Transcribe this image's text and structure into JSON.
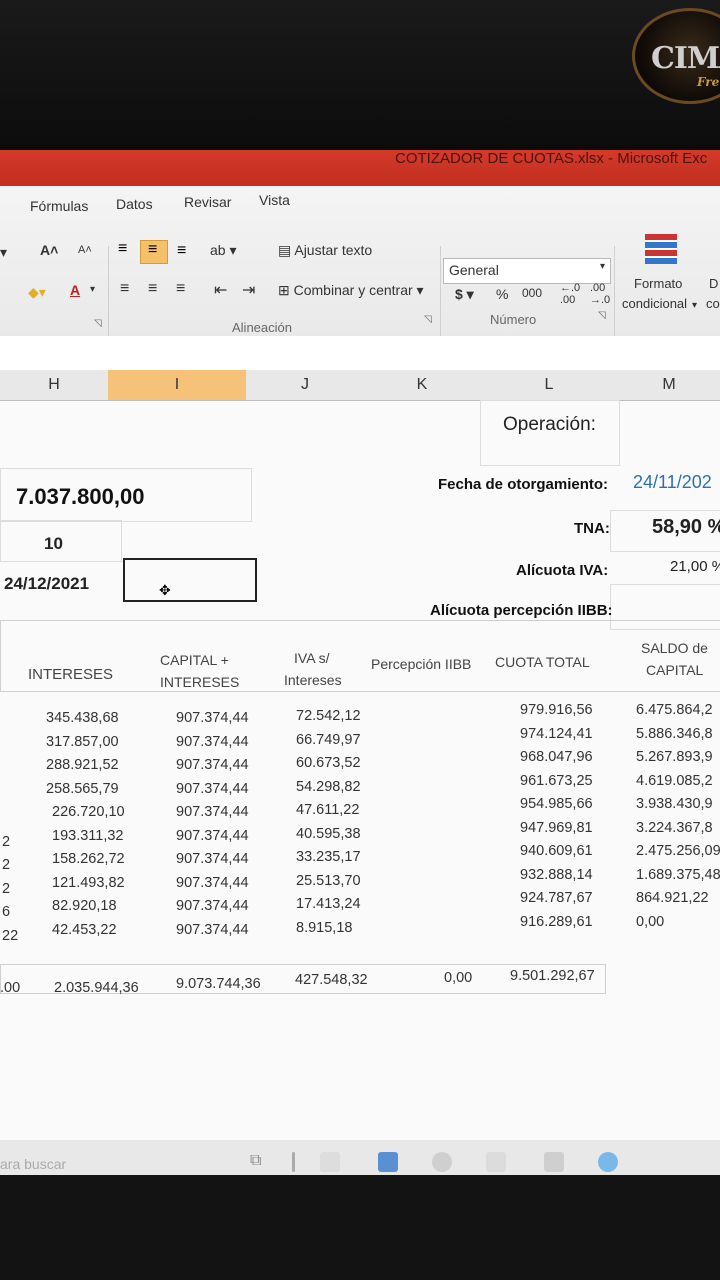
{
  "logo": {
    "text": "CIMA",
    "sub": "Fre"
  },
  "window": {
    "title": "COTIZADOR DE CUOTAS.xlsx  -  Microsoft Exc"
  },
  "ribbon": {
    "tabs": [
      "Fórmulas",
      "Datos",
      "Revisar",
      "Vista"
    ],
    "wrap_text": "Ajustar texto",
    "merge_center": "Combinar y centrar",
    "number_format": "General",
    "currency": "$",
    "percent": "%",
    "thousands": "000",
    "cond_format_1": "Formato",
    "cond_format_2": "condicional",
    "cut_label_1": "D",
    "cut_label_2": "co",
    "group_alignment": "Alineación",
    "group_number": "Número"
  },
  "columns": [
    "H",
    "I",
    "J",
    "K",
    "L",
    "M"
  ],
  "sheet": {
    "operation_label": "Operación:",
    "amount": "7.037.800,00",
    "grant_date_label": "Fecha de otorgamiento:",
    "grant_date": "24/11/202",
    "installments": "10",
    "tna_label": "TNA:",
    "tna": "58,90 %",
    "first_date": "24/12/2021",
    "iva_label": "Alícuota IVA:",
    "iva": "21,00 %",
    "iibb_label": "Alícuota percepción IIBB:"
  },
  "table": {
    "headers": {
      "intereses": "INTERESES",
      "capital_1": "CAPITAL +",
      "capital_2": "INTERESES",
      "iva_1": "IVA s/",
      "iva_2": "Intereses",
      "percepcion": "Percepción IIBB",
      "cuota": "CUOTA TOTAL",
      "saldo_1": "SALDO de",
      "saldo_2": "CAPITAL"
    },
    "left_stub": [
      "",
      "",
      "",
      "",
      "",
      "2",
      "2",
      "2",
      "6",
      "22"
    ],
    "rows": [
      [
        "345.438,68",
        "907.374,44",
        "72.542,12",
        "979.916,56",
        "6.475.864,2"
      ],
      [
        "317.857,00",
        "907.374,44",
        "66.749,97",
        "974.124,41",
        "5.886.346,8"
      ],
      [
        "288.921,52",
        "907.374,44",
        "60.673,52",
        "968.047,96",
        "5.267.893,9"
      ],
      [
        "258.565,79",
        "907.374,44",
        "54.298,82",
        "961.673,25",
        "4.619.085,2"
      ],
      [
        "226.720,10",
        "907.374,44",
        "47.611,22",
        "954.985,66",
        "3.938.430,9"
      ],
      [
        "193.311,32",
        "907.374,44",
        "40.595,38",
        "947.969,81",
        "3.224.367,8"
      ],
      [
        "158.262,72",
        "907.374,44",
        "33.235,17",
        "940.609,61",
        "2.475.256,09"
      ],
      [
        "121.493,82",
        "907.374,44",
        "25.513,70",
        "932.888,14",
        "1.689.375,48"
      ],
      [
        "82.920,18",
        "907.374,44",
        "17.413,24",
        "924.787,67",
        "864.921,22"
      ],
      [
        "42.453,22",
        "907.374,44",
        "8.915,18",
        "916.289,61",
        "0,00"
      ]
    ],
    "totals": {
      "stub": ".00",
      "intereses": "2.035.944,36",
      "capital": "9.073.744,36",
      "iva": "427.548,32",
      "percepcion": "0,00",
      "cuota": "9.501.292,67"
    }
  },
  "taskbar": {
    "search": "ara buscar"
  }
}
